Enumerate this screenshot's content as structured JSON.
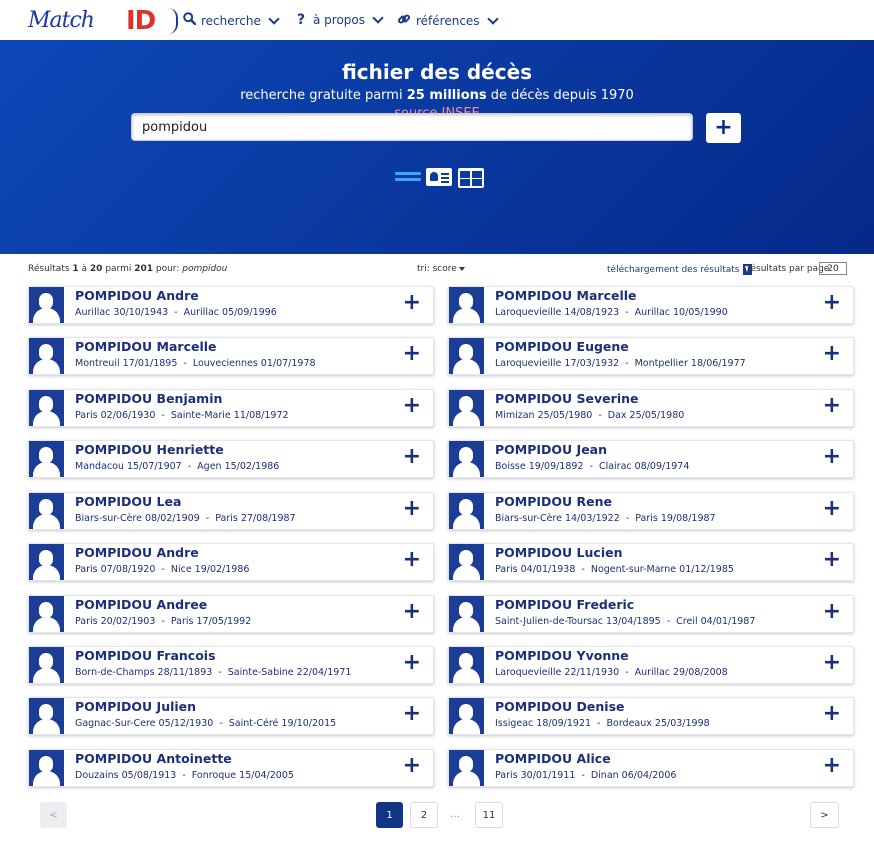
{
  "nav": {
    "logo_script": "Match",
    "logo_id": "ID",
    "items": [
      {
        "label": "recherche",
        "icon": "search-icon"
      },
      {
        "label": "à propos",
        "icon": "question-icon"
      },
      {
        "label": "références",
        "icon": "link-icon"
      }
    ]
  },
  "hero": {
    "title": "fichier des décès",
    "subtitle_pre": "recherche gratuite parmi ",
    "subtitle_bold": "25 millions",
    "subtitle_post": " de décès depuis 1970",
    "source": "source INSEE"
  },
  "search": {
    "value": "pompidou",
    "add_label": "+"
  },
  "results_bar": {
    "prefix": "Résultats ",
    "from": "1",
    "to_word": " à ",
    "to": "20",
    "among": " parmi ",
    "total": "201",
    "pour": " pour: ",
    "query": "pompidou",
    "sort_label": "tri: score",
    "download_label": "téléchargement des résultats",
    "per_page_label": "résultats par page",
    "per_page_value": "20"
  },
  "results": [
    {
      "name": "POMPIDOU Andre",
      "birth": "Aurillac 30/10/1943",
      "death": "Aurillac 05/09/1996"
    },
    {
      "name": "POMPIDOU Marcelle",
      "birth": "Laroquevieille 14/08/1923",
      "death": "Aurillac 10/05/1990"
    },
    {
      "name": "POMPIDOU Marcelle",
      "birth": "Montreuil 17/01/1895",
      "death": "Louveciennes 01/07/1978"
    },
    {
      "name": "POMPIDOU Eugene",
      "birth": "Laroquevieille 17/03/1932",
      "death": "Montpellier 18/06/1977"
    },
    {
      "name": "POMPIDOU Benjamin",
      "birth": "Paris 02/06/1930",
      "death": "Sainte-Marie 11/08/1972"
    },
    {
      "name": "POMPIDOU Severine",
      "birth": "Mimizan 25/05/1980",
      "death": "Dax 25/05/1980"
    },
    {
      "name": "POMPIDOU Henriette",
      "birth": "Mandacou 15/07/1907",
      "death": "Agen 15/02/1986"
    },
    {
      "name": "POMPIDOU Jean",
      "birth": "Boisse 19/09/1892",
      "death": "Clairac 08/09/1974"
    },
    {
      "name": "POMPIDOU Lea",
      "birth": "Biars-sur-Cère 08/02/1909",
      "death": "Paris 27/08/1987"
    },
    {
      "name": "POMPIDOU Rene",
      "birth": "Biars-sur-Cère 14/03/1922",
      "death": "Paris 19/08/1987"
    },
    {
      "name": "POMPIDOU Andre",
      "birth": "Paris 07/08/1920",
      "death": "Nice 19/02/1986"
    },
    {
      "name": "POMPIDOU Lucien",
      "birth": "Paris 04/01/1938",
      "death": "Nogent-sur-Marne 01/12/1985"
    },
    {
      "name": "POMPIDOU Andree",
      "birth": "Paris 20/02/1903",
      "death": "Paris 17/05/1992"
    },
    {
      "name": "POMPIDOU Frederic",
      "birth": "Saint-Julien-de-Toursac 13/04/1895",
      "death": "Creil 04/01/1987"
    },
    {
      "name": "POMPIDOU Francois",
      "birth": "Born-de-Champs 28/11/1893",
      "death": "Sainte-Sabine 22/04/1971"
    },
    {
      "name": "POMPIDOU Yvonne",
      "birth": "Laroquevieille 22/11/1930",
      "death": "Aurillac 29/08/2008"
    },
    {
      "name": "POMPIDOU Julien",
      "birth": "Gagnac-Sur-Cere 05/12/1930",
      "death": "Saint-Céré 19/10/2015"
    },
    {
      "name": "POMPIDOU Denise",
      "birth": "Issigeac 18/09/1921",
      "death": "Bordeaux 25/03/1998"
    },
    {
      "name": "POMPIDOU Antoinette",
      "birth": "Douzains 05/08/1913",
      "death": "Fonroque 15/04/2005"
    },
    {
      "name": "POMPIDOU Alice",
      "birth": "Paris 30/01/1911",
      "death": "Dinan 06/04/2006"
    }
  ],
  "pagination": {
    "prev": "<",
    "pages": [
      "1",
      "2",
      "11"
    ],
    "ellipsis": "…",
    "next": ">",
    "current": "1"
  }
}
